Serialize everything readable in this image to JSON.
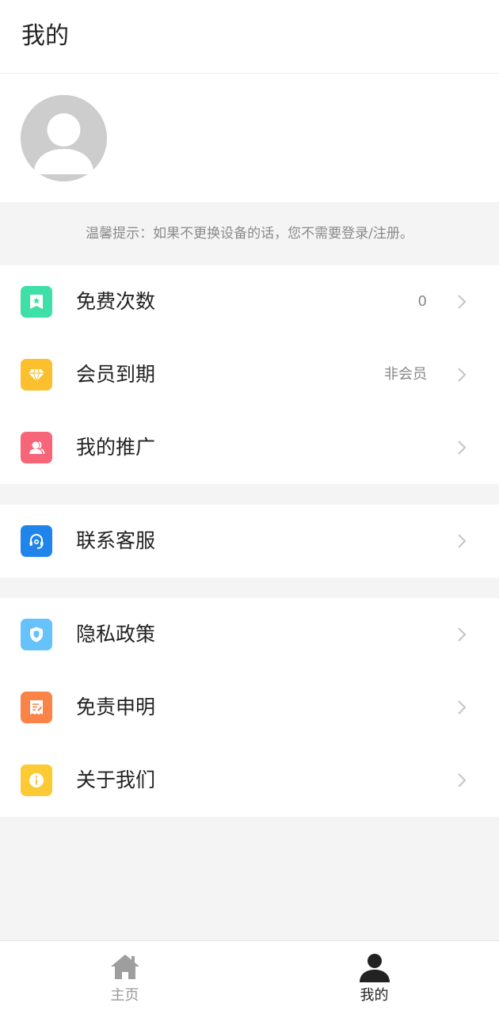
{
  "header": {
    "title": "我的"
  },
  "tip": {
    "text": "温馨提示：如果不更换设备的话，您不需要登录/注册。"
  },
  "menu": {
    "free_count": {
      "label": "免费次数",
      "value": "0",
      "icon": "ticket-star-icon",
      "color": "#3ee0a8"
    },
    "vip_expire": {
      "label": "会员到期",
      "value": "非会员",
      "icon": "diamond-icon",
      "color": "#fcc02f"
    },
    "promotion": {
      "label": "我的推广",
      "value": "",
      "icon": "users-icon",
      "color": "#f76578"
    },
    "support": {
      "label": "联系客服",
      "value": "",
      "icon": "headset-icon",
      "color": "#1f85ea"
    },
    "privacy": {
      "label": "隐私政策",
      "value": "",
      "icon": "shield-icon",
      "color": "#66c2fb"
    },
    "disclaimer": {
      "label": "免责申明",
      "value": "",
      "icon": "document-edit-icon",
      "color": "#fa8347"
    },
    "about": {
      "label": "关于我们",
      "value": "",
      "icon": "info-icon",
      "color": "#fcca35"
    }
  },
  "tabbar": {
    "home": {
      "label": "主页",
      "icon": "home-icon",
      "color": "#9e9e9e"
    },
    "mine": {
      "label": "我的",
      "icon": "user-icon",
      "color": "#222222",
      "active": true
    }
  }
}
